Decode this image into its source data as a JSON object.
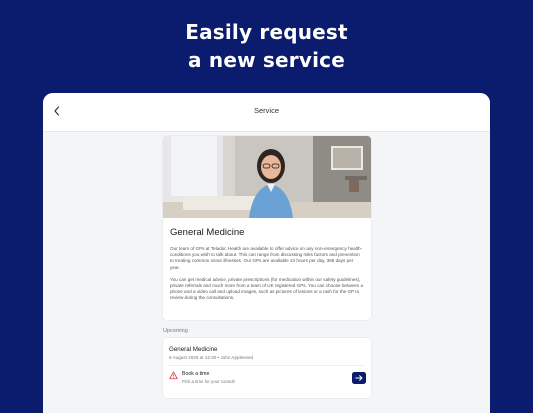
{
  "promo": {
    "line1": "Easily request",
    "line2": "a new service"
  },
  "header": {
    "back_icon": "chevron-left-icon",
    "title": "Service"
  },
  "service": {
    "title": "General Medicine",
    "paragraph1": "Our team of GPs at Teladoc Health are available to offer advice on any non-emergency health-conditions you wish to talk about. This can range from discussing risks factors and prevention to treating common minor illnesses. Our GPs are available 24 hours per day, 365 days per year.",
    "paragraph2": "You can get medical advice, private prescriptions (for medication within our safety guidelines), private referrals and much more from a team of UK registered GPs. You can choose between a phone and a video call and upload images, such as pictures of lesions or a rash for the GP to review during the consultations."
  },
  "upcoming": {
    "label": "Upcoming",
    "appointment": {
      "title": "General Medicine",
      "meta": "8 August 2025 at 12:30 • John Appleseed",
      "action_title": "Book a time",
      "action_subtitle": "Pick a time for your consult",
      "warning_icon": "warning-triangle-icon",
      "button_icon": "arrow-right-icon"
    }
  },
  "colors": {
    "background": "#0b1b6e",
    "accent": "#0b1b6e",
    "warning": "#e0353b"
  }
}
